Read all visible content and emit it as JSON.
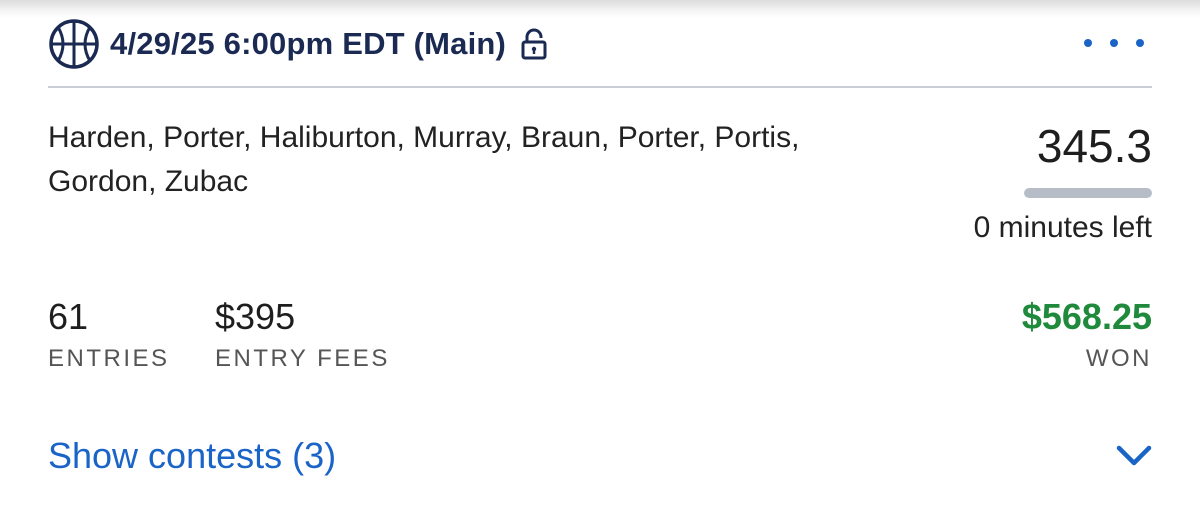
{
  "header": {
    "slate_title": "4/29/25 6:00pm EDT (Main)",
    "sport_icon": "basketball-icon",
    "lock_icon": "unlock-icon",
    "more_icon": "more-horizontal-icon"
  },
  "lineup": {
    "players_text": "Harden, Porter, Haliburton, Murray, Braun, Porter, Portis, Gordon, Zubac",
    "score": "345.3",
    "progress_complete": 1.0,
    "time_left": "0 minutes left"
  },
  "stats": {
    "entries": {
      "value": "61",
      "label": "ENTRIES"
    },
    "entry_fees": {
      "value": "$395",
      "label": "ENTRY FEES"
    },
    "won": {
      "value": "$568.25",
      "label": "WON"
    }
  },
  "footer": {
    "show_contests_label": "Show contests (3)",
    "expand_icon": "chevron-down-icon"
  },
  "colors": {
    "title_navy": "#1b2a52",
    "accent_blue": "#1a64c8",
    "won_green": "#1f8a3c"
  }
}
